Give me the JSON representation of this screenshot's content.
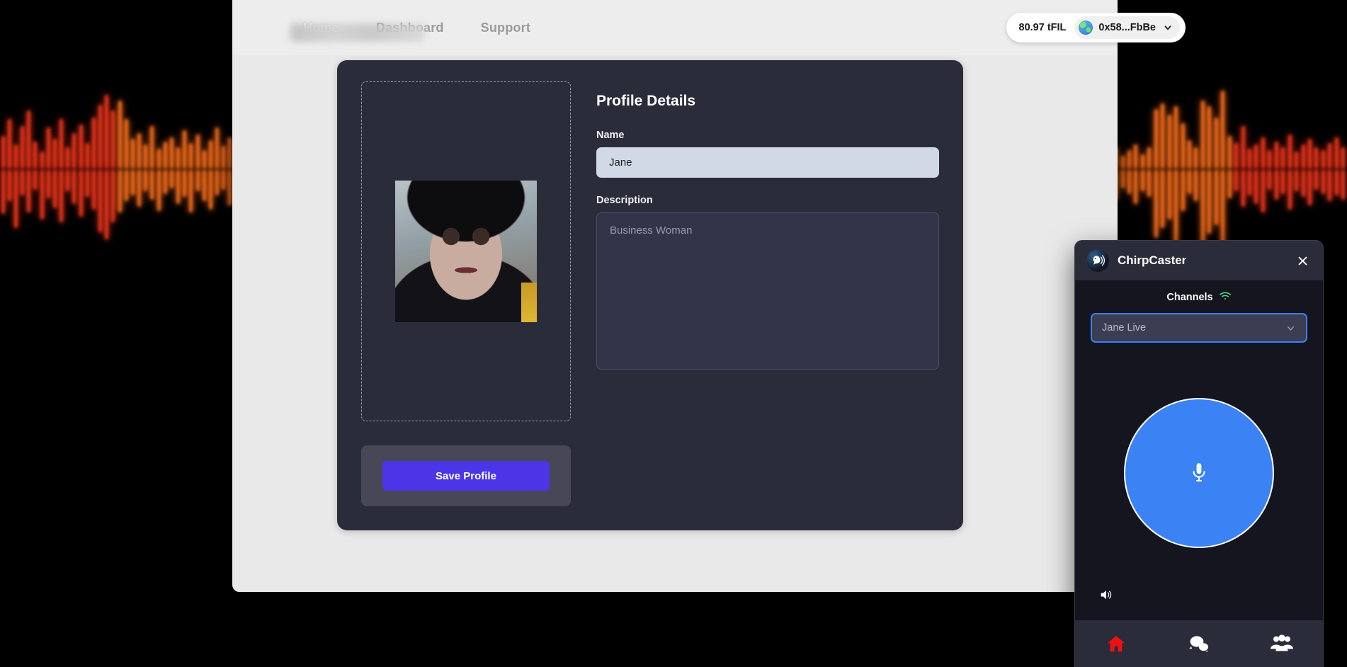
{
  "nav": {
    "links": [
      {
        "label": "Home",
        "active": true
      },
      {
        "label": "Dashboard",
        "active": false
      },
      {
        "label": "Support",
        "active": false
      }
    ]
  },
  "wallet": {
    "balance": "80.97 tFIL",
    "address": "0x58...FbBe",
    "globe_icon": "globe-icon",
    "caret_icon": "chevron-down-icon"
  },
  "profile": {
    "title": "Profile Details",
    "name_label": "Name",
    "name_value": "Jane",
    "name_placeholder": "Name",
    "description_label": "Description",
    "description_value": "",
    "description_placeholder": "Business Woman",
    "save_label": "Save Profile",
    "dropzone_name": "image-dropzone",
    "photo_alt": "profile-photo"
  },
  "chirpcaster": {
    "title": "ChirpCaster",
    "logo_icon": "bird-broadcast-icon",
    "close_icon": "close-icon",
    "channels_label": "Channels",
    "signal_icon": "wifi-icon",
    "channel_selected": "Jane Live",
    "channel_caret_icon": "chevron-down-icon",
    "mic_icon": "microphone-icon",
    "volume_icon": "speaker-icon",
    "nav": [
      {
        "icon": "home-icon",
        "name": "chirp-nav-home",
        "active": true
      },
      {
        "icon": "chat-bubbles-icon",
        "name": "chirp-nav-chat",
        "active": false
      },
      {
        "icon": "people-group-icon",
        "name": "chirp-nav-people",
        "active": false
      }
    ]
  },
  "colors": {
    "accent_purple": "#4b35e6",
    "accent_blue": "#3b82f5",
    "focus_blue": "#3b7ff5",
    "signal_green": "#4ade80",
    "nav_active_red": "#ee1111",
    "card_dark": "#2b2c3a",
    "widget_dark": "#14151f",
    "page_light": "#e9e9e9",
    "waveform_red": "#e8341b",
    "waveform_orange": "#f26a1b"
  },
  "waveform": {
    "left_up": [
      46,
      70,
      34,
      60,
      82,
      38,
      24,
      58,
      42,
      70,
      30,
      50,
      62,
      36,
      72,
      90,
      104,
      82,
      96,
      70,
      42,
      50,
      34,
      60,
      28,
      38,
      44,
      30,
      54,
      36,
      48,
      26,
      40,
      58,
      32,
      44
    ],
    "left_down": [
      62,
      44,
      82,
      36,
      60,
      28,
      70,
      40,
      54,
      74,
      30,
      48,
      66,
      38,
      56,
      88,
      98,
      74,
      60,
      44,
      36,
      52,
      30,
      42,
      58,
      34,
      26,
      48,
      38,
      60,
      30,
      44,
      56,
      36,
      28,
      50
    ],
    "right_up": [
      22,
      30,
      18,
      26,
      34,
      20,
      30,
      84,
      92,
      76,
      88,
      64,
      40,
      30,
      96,
      88,
      72,
      110,
      46,
      36,
      60,
      28,
      34,
      44,
      26,
      38,
      30,
      48,
      24,
      34,
      42,
      30,
      26,
      36,
      44,
      30
    ],
    "right_down": [
      30,
      42,
      26,
      34,
      48,
      30,
      38,
      96,
      82,
      70,
      104,
      58,
      34,
      44,
      108,
      90,
      78,
      124,
      40,
      30,
      52,
      36,
      48,
      60,
      28,
      42,
      34,
      56,
      30,
      38,
      50,
      28,
      34,
      44,
      36,
      42
    ]
  }
}
